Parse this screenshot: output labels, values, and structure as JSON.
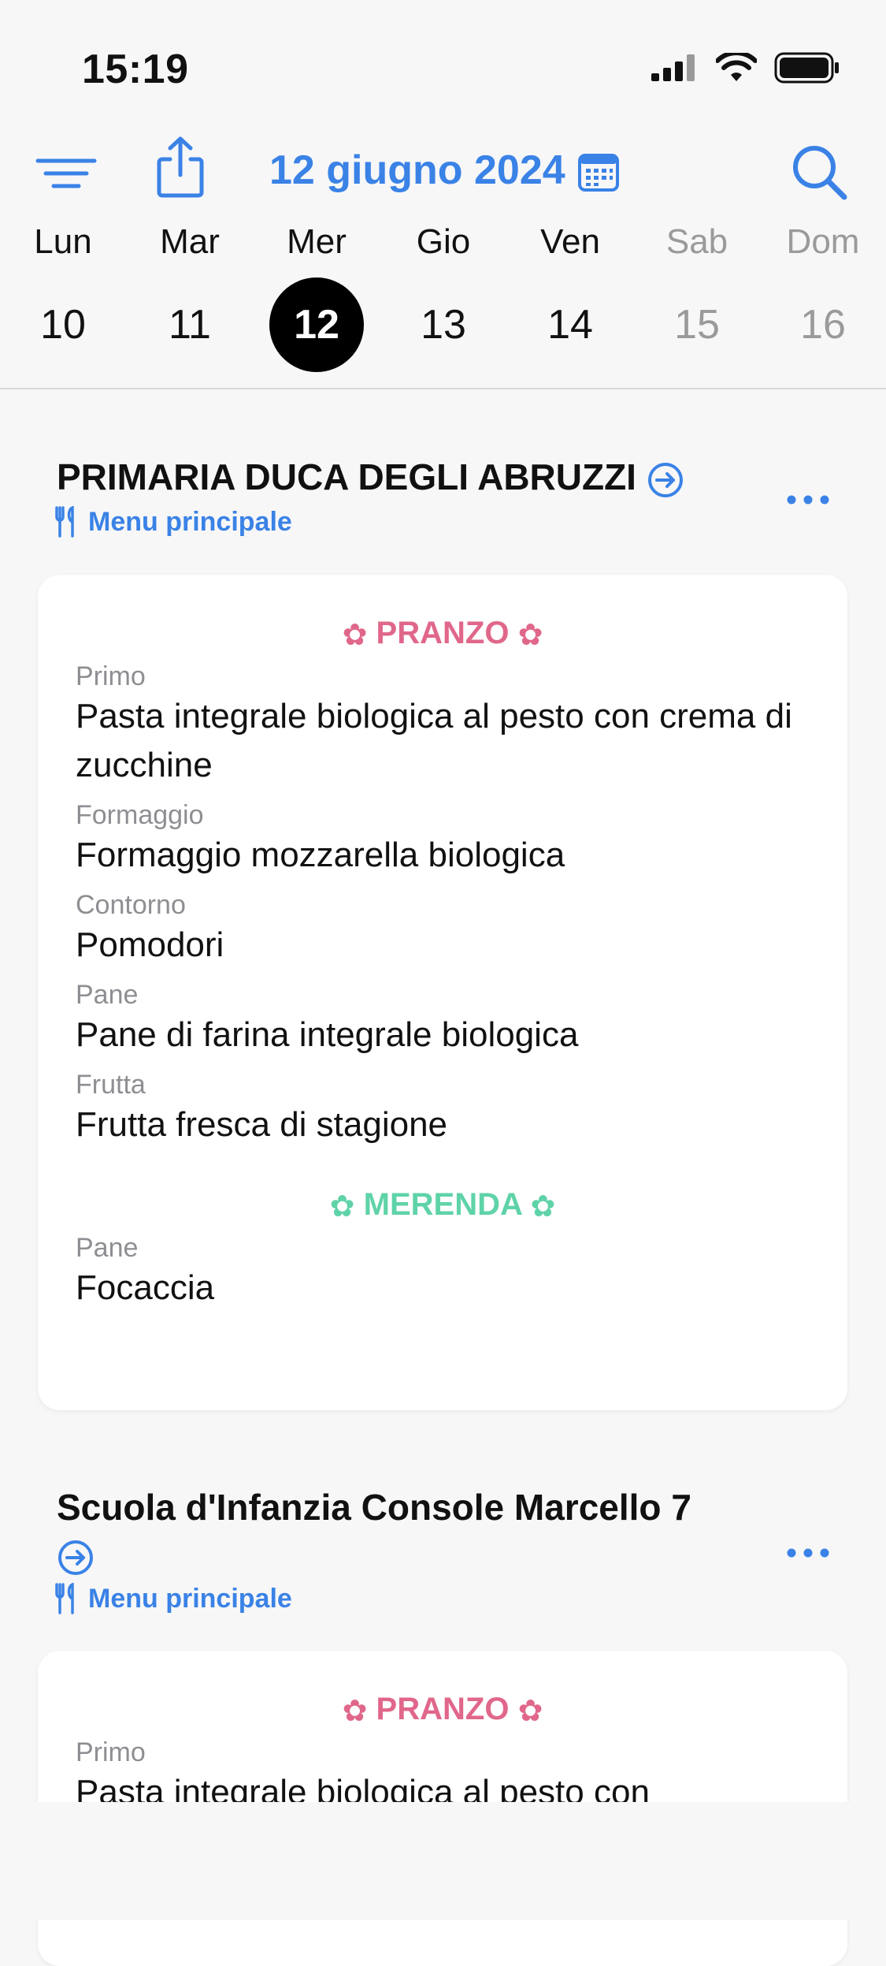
{
  "status_bar": {
    "time": "15:19"
  },
  "toolbar": {
    "date_title": "12 giugno 2024",
    "accent_color": "#3a82e6",
    "icons": [
      "menu-lines-icon",
      "share-icon",
      "calendar-icon",
      "search-icon"
    ]
  },
  "week": [
    {
      "name": "Lun",
      "num": "10",
      "weekend": false,
      "selected": false
    },
    {
      "name": "Mar",
      "num": "11",
      "weekend": false,
      "selected": false
    },
    {
      "name": "Mer",
      "num": "12",
      "weekend": false,
      "selected": true
    },
    {
      "name": "Gio",
      "num": "13",
      "weekend": false,
      "selected": false
    },
    {
      "name": "Ven",
      "num": "14",
      "weekend": false,
      "selected": false
    },
    {
      "name": "Sab",
      "num": "15",
      "weekend": true,
      "selected": false
    },
    {
      "name": "Dom",
      "num": "16",
      "weekend": true,
      "selected": false
    }
  ],
  "schools": [
    {
      "title": "PRIMARIA DUCA DEGLI ABRUZZI",
      "menu_label": "Menu principale",
      "sections": [
        {
          "title": "PRANZO",
          "color": "#e0678a",
          "items": [
            {
              "label": "Primo",
              "value": "Pasta integrale biologica al pesto con crema di zucchine"
            },
            {
              "label": "Formaggio",
              "value": "Formaggio mozzarella biologica"
            },
            {
              "label": "Contorno",
              "value": "Pomodori"
            },
            {
              "label": "Pane",
              "value": "Pane di farina integrale biologica"
            },
            {
              "label": "Frutta",
              "value": "Frutta fresca di stagione"
            }
          ]
        },
        {
          "title": "MERENDA",
          "color": "#5fd3a8",
          "items": [
            {
              "label": "Pane",
              "value": "Focaccia"
            }
          ]
        }
      ]
    },
    {
      "title": "Scuola d'Infanzia Console Marcello 7",
      "menu_label": "Menu principale",
      "sections": [
        {
          "title": "PRANZO",
          "color": "#e0678a",
          "items": [
            {
              "label": "Primo",
              "value": "Pasta integrale biologica al pesto con"
            }
          ]
        }
      ]
    }
  ]
}
